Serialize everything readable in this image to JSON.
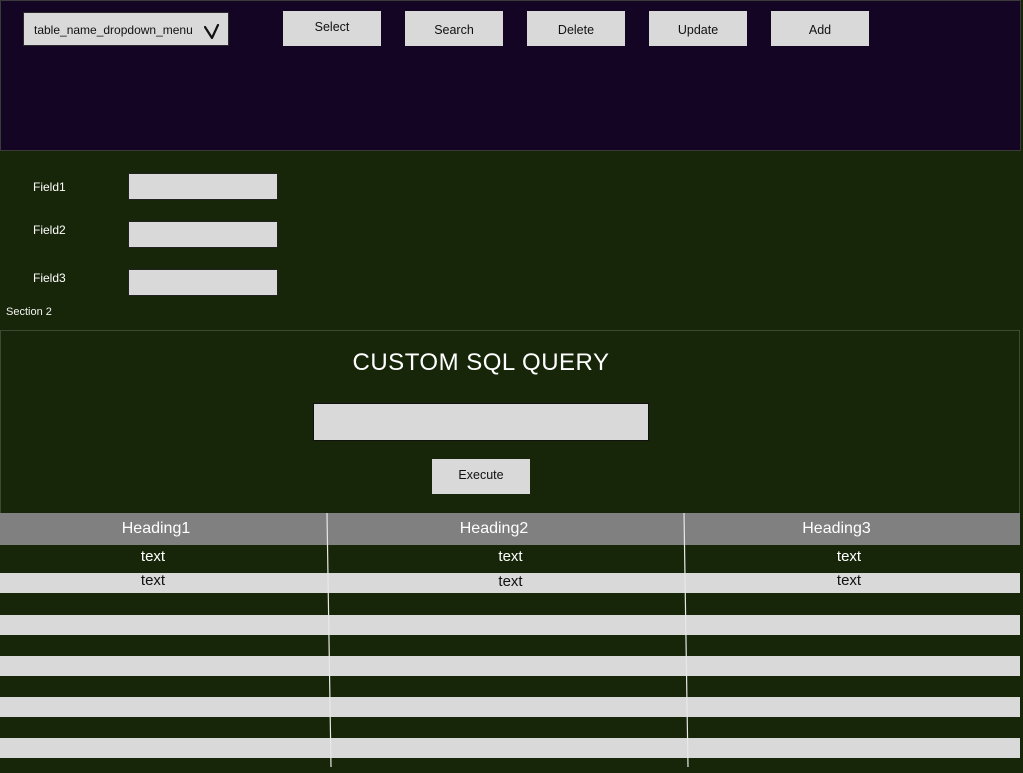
{
  "toolbar": {
    "dropdown": {
      "selected": "table_name_dropdown_menu",
      "icon": "chevron-down-icon"
    },
    "buttons": {
      "select": "Select",
      "search": "Search",
      "delete": "Delete",
      "update": "Update",
      "add": "Add"
    }
  },
  "fields": [
    {
      "label": "Field1",
      "value": ""
    },
    {
      "label": "Field2",
      "value": ""
    },
    {
      "label": "Field3",
      "value": ""
    }
  ],
  "section2_label": "Section 2",
  "sql": {
    "title": "CUSTOM SQL QUERY",
    "query_value": "",
    "execute_label": "Execute"
  },
  "results": {
    "headers": [
      "Heading1",
      "Heading2",
      "Heading3"
    ],
    "rows": [
      [
        "text",
        "text",
        "text"
      ],
      [
        "text",
        "text",
        "text"
      ],
      [
        "",
        "",
        ""
      ],
      [
        "",
        "",
        ""
      ],
      [
        "",
        "",
        ""
      ],
      [
        "",
        "",
        ""
      ],
      [
        "",
        "",
        ""
      ],
      [
        "",
        "",
        ""
      ],
      [
        "",
        "",
        ""
      ],
      [
        "",
        "",
        ""
      ],
      [
        "",
        "",
        ""
      ]
    ]
  },
  "colors": {
    "toolbar_bg": "#150524",
    "page_bg": "#172609",
    "control_fill": "#d9d9d9",
    "table_header_bg": "#808080"
  }
}
